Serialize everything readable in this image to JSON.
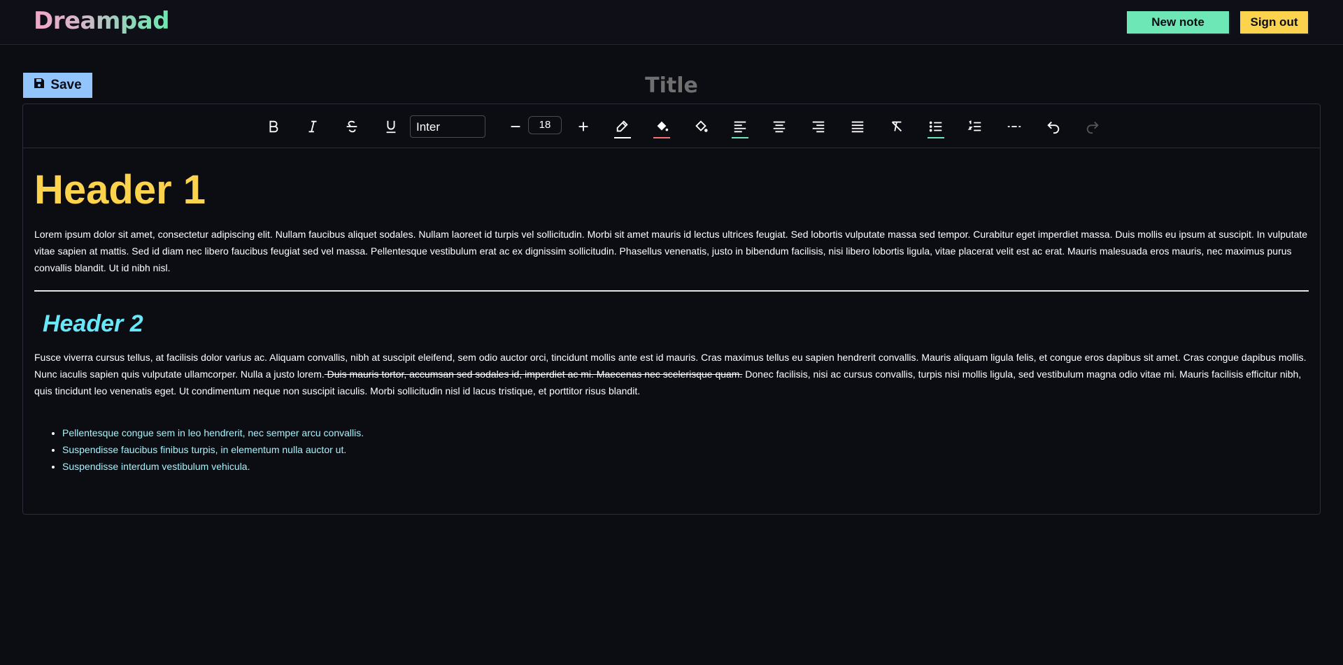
{
  "app": {
    "logo": "Dreampad",
    "new_note": "New note",
    "sign_out": "Sign out"
  },
  "editor": {
    "save_label": "Save",
    "title_placeholder": "Title",
    "toolbar": {
      "font_family": "Inter",
      "font_size": "18",
      "icons": [
        "bold-icon",
        "italic-icon",
        "strikethrough-icon",
        "underline-icon",
        "minus-icon",
        "plus-icon",
        "pen-icon",
        "fill-bucket-icon",
        "paint-bucket-icon",
        "align-left-icon",
        "align-center-icon",
        "align-right-icon",
        "align-justify-icon",
        "clear-format-icon",
        "bullet-list-icon",
        "numbered-list-icon",
        "horizontal-rule-icon",
        "undo-icon",
        "redo-icon"
      ]
    },
    "content": {
      "header1": "Header 1",
      "paragraph1": "Lorem ipsum dolor sit amet, consectetur adipiscing elit. Nullam faucibus aliquet sodales. Nullam laoreet id turpis vel sollicitudin. Morbi sit amet mauris id lectus ultrices feugiat. Sed lobortis vulputate massa sed tempor. Curabitur eget imperdiet massa. Duis mollis eu ipsum at suscipit. In vulputate vitae sapien at mattis. Sed id diam nec libero faucibus feugiat sed vel massa. Pellentesque vestibulum erat ac ex dignissim sollicitudin. Phasellus venenatis, justo in bibendum facilisis, nisi libero lobortis ligula, vitae placerat velit est ac erat. Mauris malesuada eros mauris, nec maximus purus convallis blandit. Ut id nibh nisl.",
      "header2": "Header 2",
      "paragraph2_before": "Fusce viverra cursus tellus, at facilisis dolor varius ac. Aliquam convallis, nibh at suscipit eleifend, sem odio auctor orci, tincidunt mollis ante est id mauris. Cras maximus tellus eu sapien hendrerit convallis. Mauris aliquam ligula felis, et congue eros dapibus sit amet. Cras congue dapibus mollis. Nunc iaculis sapien quis vulputate ullamcorper. Nulla a justo lorem.",
      "paragraph2_strike": " Duis mauris tortor, accumsan sed sodales id, imperdiet ac mi. Maecenas nec scelerisque quam.",
      "paragraph2_after": " Donec facilisis, nisi ac cursus convallis, turpis nisi mollis ligula, sed vestibulum magna odio vitae mi. Mauris facilisis efficitur nibh, quis tincidunt leo venenatis eget. Ut condimentum neque non suscipit iaculis. Morbi sollicitudin nisl id lacus tristique, et porttitor risus blandit.",
      "list": [
        "Pellentesque congue sem in leo hendrerit, nec semper arcu convallis.",
        "Suspendisse faucibus finibus turpis, in elementum nulla auctor ut.",
        "Suspendisse interdum vestibulum vehicula."
      ]
    }
  },
  "colors": {
    "background": "#0c0c13",
    "new_note": "#6ee7b7",
    "sign_out": "#fcd34d",
    "save": "#93c5fd",
    "header1": "#fcd34d",
    "header2": "#67e8f9",
    "list_text": "#a5f3fc"
  }
}
